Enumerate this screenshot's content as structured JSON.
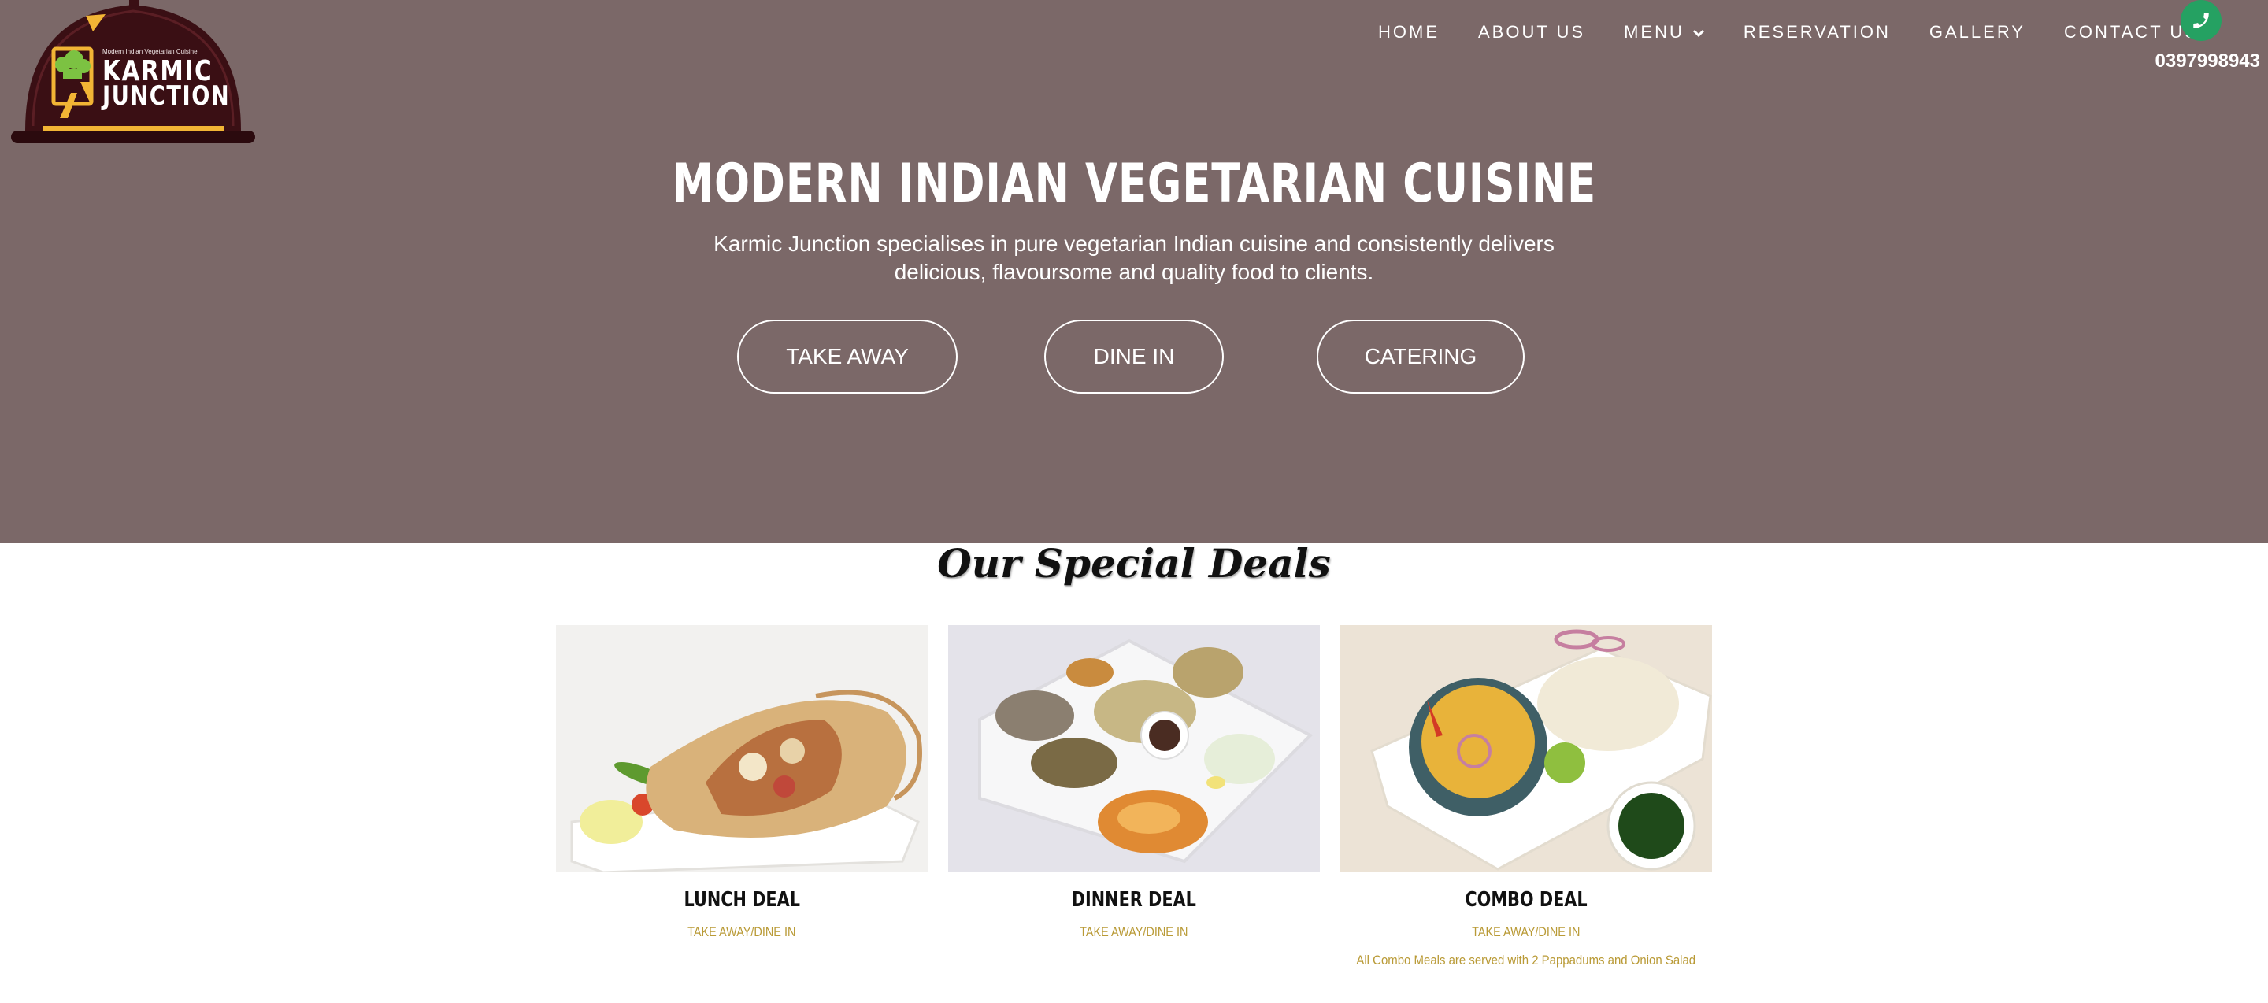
{
  "logo": {
    "tagline": "Modern Indian Vegetarian Cuisine",
    "word1": "KARMIC",
    "word2": "JUNCTION"
  },
  "nav": {
    "items": [
      "HOME",
      "ABOUT US",
      "MENU",
      "RESERVATION",
      "GALLERY",
      "CONTACT US"
    ],
    "phone": "0397998943"
  },
  "hero": {
    "title": "MODERN INDIAN VEGETARIAN CUISINE",
    "subtitle": "Karmic Junction specialises in pure vegetarian Indian cuisine and consistently delivers delicious, flavoursome and quality food to clients.",
    "buttons": [
      "TAKE AWAY",
      "DINE IN",
      "CATERING"
    ]
  },
  "deals": {
    "title": "Our Special Deals",
    "items": [
      {
        "name": "LUNCH DEAL",
        "type": "TAKE AWAY/DINE IN",
        "note": ""
      },
      {
        "name": "DINNER DEAL",
        "type": "TAKE AWAY/DINE IN",
        "note": ""
      },
      {
        "name": "COMBO DEAL",
        "type": "TAKE AWAY/DINE IN",
        "note": "All Combo Meals are served with 2 Pappadums and Onion Salad"
      }
    ]
  },
  "colors": {
    "hero_bg": "#7b6868",
    "logo_bg": "#3a0f14",
    "accent_gold": "#b99a36",
    "phone_green": "#25a162"
  },
  "icons": [
    "phone-icon",
    "chevron-down-icon",
    "chef-hat-icon"
  ]
}
